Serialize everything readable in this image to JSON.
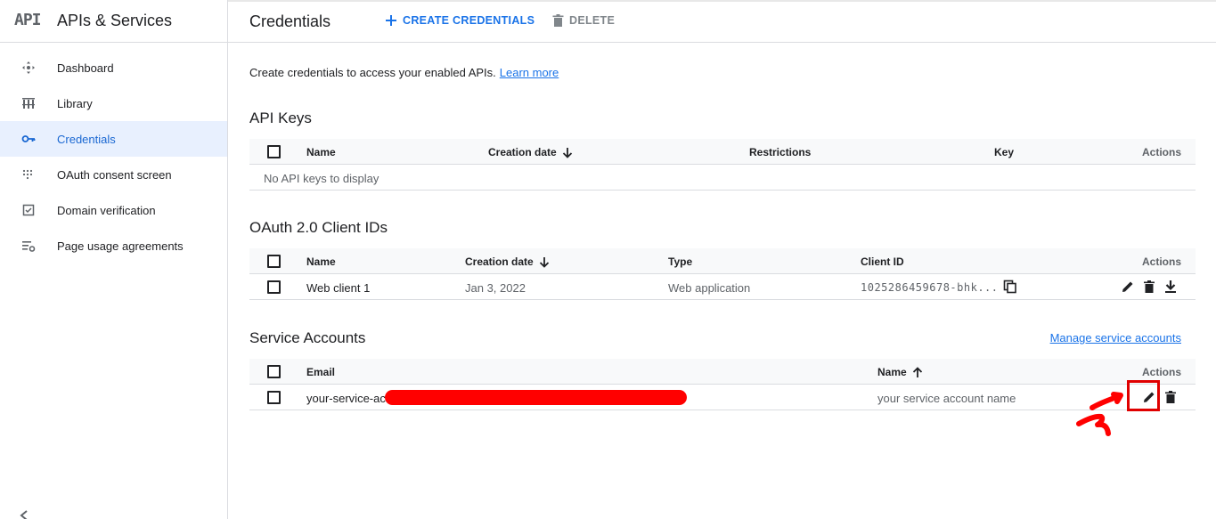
{
  "header": {
    "logo_text": "API",
    "product_title": "APIs & Services",
    "page_title": "Credentials",
    "create_label": "CREATE CREDENTIALS",
    "delete_label": "DELETE"
  },
  "sidebar": {
    "items": [
      {
        "label": "Dashboard",
        "icon": "dashboard-icon",
        "active": false
      },
      {
        "label": "Library",
        "icon": "library-icon",
        "active": false
      },
      {
        "label": "Credentials",
        "icon": "key-icon",
        "active": true
      },
      {
        "label": "OAuth consent screen",
        "icon": "consent-icon",
        "active": false
      },
      {
        "label": "Domain verification",
        "icon": "checkbox-icon",
        "active": false
      },
      {
        "label": "Page usage agreements",
        "icon": "settings-list-icon",
        "active": false
      }
    ]
  },
  "main": {
    "intro_text": "Create credentials to access your enabled APIs.",
    "learn_more": "Learn more",
    "api_keys": {
      "title": "API Keys",
      "columns": [
        "Name",
        "Creation date",
        "Restrictions",
        "Key",
        "Actions"
      ],
      "empty_text": "No API keys to display"
    },
    "oauth": {
      "title": "OAuth 2.0 Client IDs",
      "columns": [
        "Name",
        "Creation date",
        "Type",
        "Client ID",
        "Actions"
      ],
      "rows": [
        {
          "name": "Web client 1",
          "created": "Jan 3, 2022",
          "type": "Web application",
          "client_id": "1025286459678-bhk..."
        }
      ]
    },
    "service_accounts": {
      "title": "Service Accounts",
      "manage_link": "Manage service accounts",
      "columns": [
        "Email",
        "Name",
        "Actions"
      ],
      "rows": [
        {
          "email": "your-service-ac",
          "name": "your service account name"
        }
      ]
    }
  },
  "colors": {
    "accent": "#1a73e8",
    "active_bg": "#e8f0fe",
    "annotation_red": "#ff0000"
  }
}
